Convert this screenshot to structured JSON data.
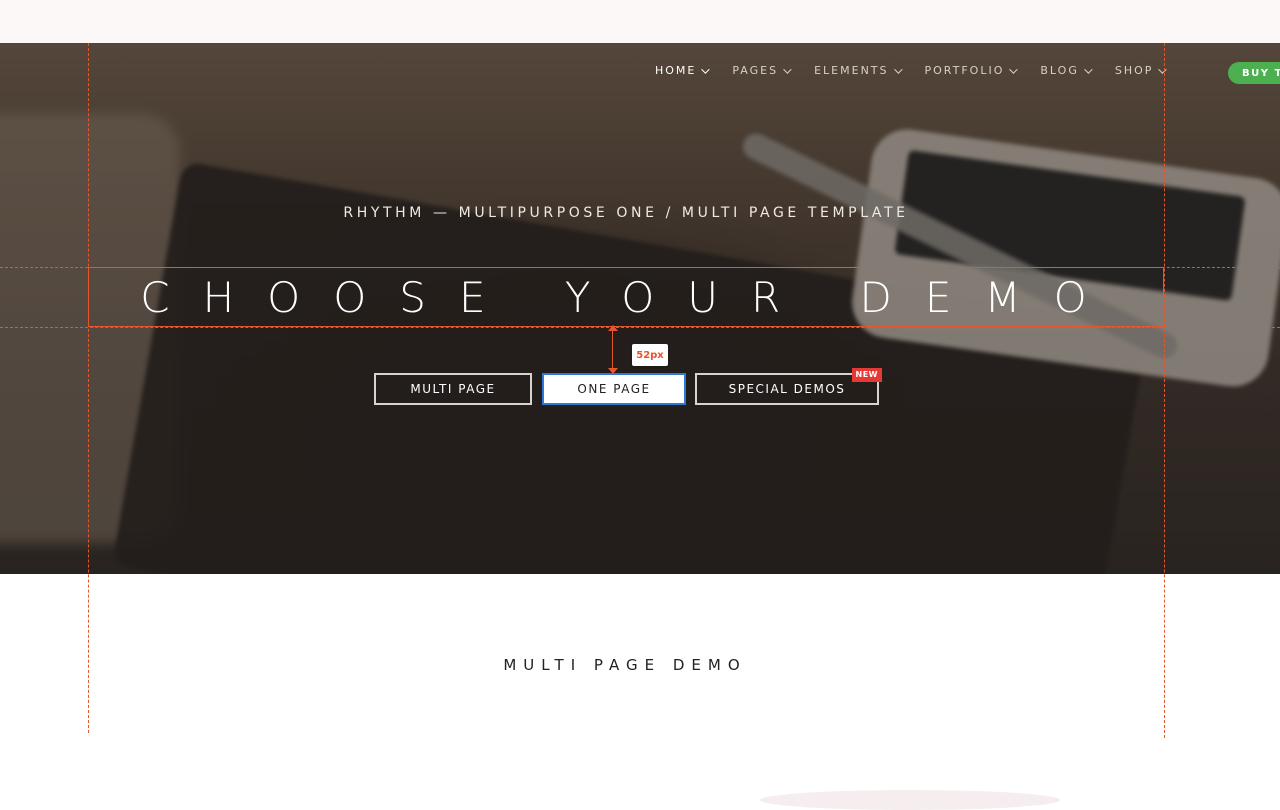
{
  "nav": {
    "items": [
      {
        "label": "HOME",
        "active": true
      },
      {
        "label": "PAGES"
      },
      {
        "label": "ELEMENTS"
      },
      {
        "label": "PORTFOLIO"
      },
      {
        "label": "BLOG"
      },
      {
        "label": "SHOP"
      }
    ],
    "buy_label": "BUY T"
  },
  "hero": {
    "subtitle": "RHYTHM — MULTIPURPOSE ONE / MULTI PAGE TEMPLATE",
    "headline": "CHOOSE YOUR DEMO",
    "buttons": {
      "multi": "MULTI PAGE",
      "one": "ONE PAGE",
      "special": "SPECIAL DEMOS",
      "special_badge": "NEW"
    }
  },
  "measurement": {
    "label": "52px",
    "color": "#e8552a"
  },
  "section": {
    "title": "MULTI PAGE DEMO"
  },
  "colors": {
    "accent_green": "#4caf50",
    "badge_red": "#e53935",
    "focus_blue": "#2f78d6",
    "guide_orange": "#e8552a"
  }
}
